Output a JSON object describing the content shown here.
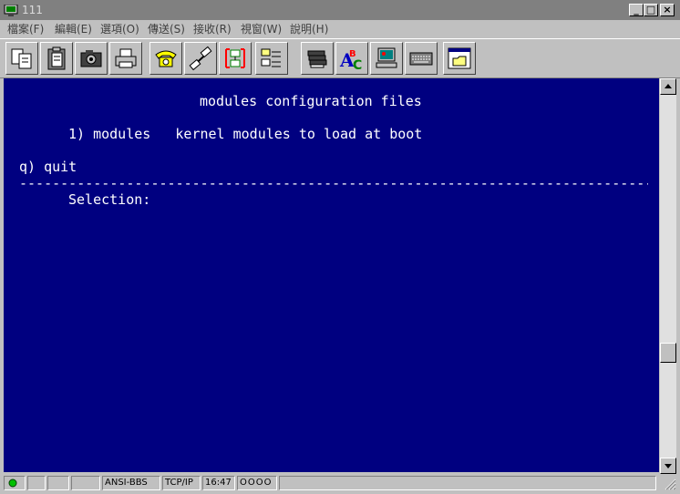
{
  "window": {
    "title": "111",
    "minimize_label": "_",
    "maximize_label": "□",
    "close_label": "×"
  },
  "menu": {
    "items": [
      {
        "label": "檔案(F)"
      },
      {
        "label": "編輯(E)"
      },
      {
        "label": "選項(O)"
      },
      {
        "label": "傳送(S)"
      },
      {
        "label": "接收(R)"
      },
      {
        "label": "視窗(W)"
      },
      {
        "label": "說明(H)"
      }
    ]
  },
  "toolbar": {
    "buttons": [
      {
        "icon": "copy-icon"
      },
      {
        "icon": "paste-icon"
      },
      {
        "icon": "camera-icon"
      },
      {
        "icon": "printer-icon"
      },
      {
        "icon": "phone-icon"
      },
      {
        "icon": "disconnect-icon"
      },
      {
        "icon": "transfer-icon"
      },
      {
        "icon": "file-manager-icon"
      },
      {
        "icon": "stack-icon"
      },
      {
        "icon": "abc-font-icon"
      },
      {
        "icon": "computer-icon"
      },
      {
        "icon": "keyboard-icon"
      },
      {
        "icon": "folder-window-icon"
      }
    ]
  },
  "terminal": {
    "lines": [
      "modules configuration files",
      "1) modules   kernel modules to load at boot",
      "q) quit",
      "-----------------------------------------------------------------------------",
      "Selection:"
    ]
  },
  "statusbar": {
    "emulation": "ANSI-BBS",
    "protocol": "TCP/IP",
    "time": "16:47",
    "indicators": "OOOO",
    "status_color": "#00c000"
  }
}
